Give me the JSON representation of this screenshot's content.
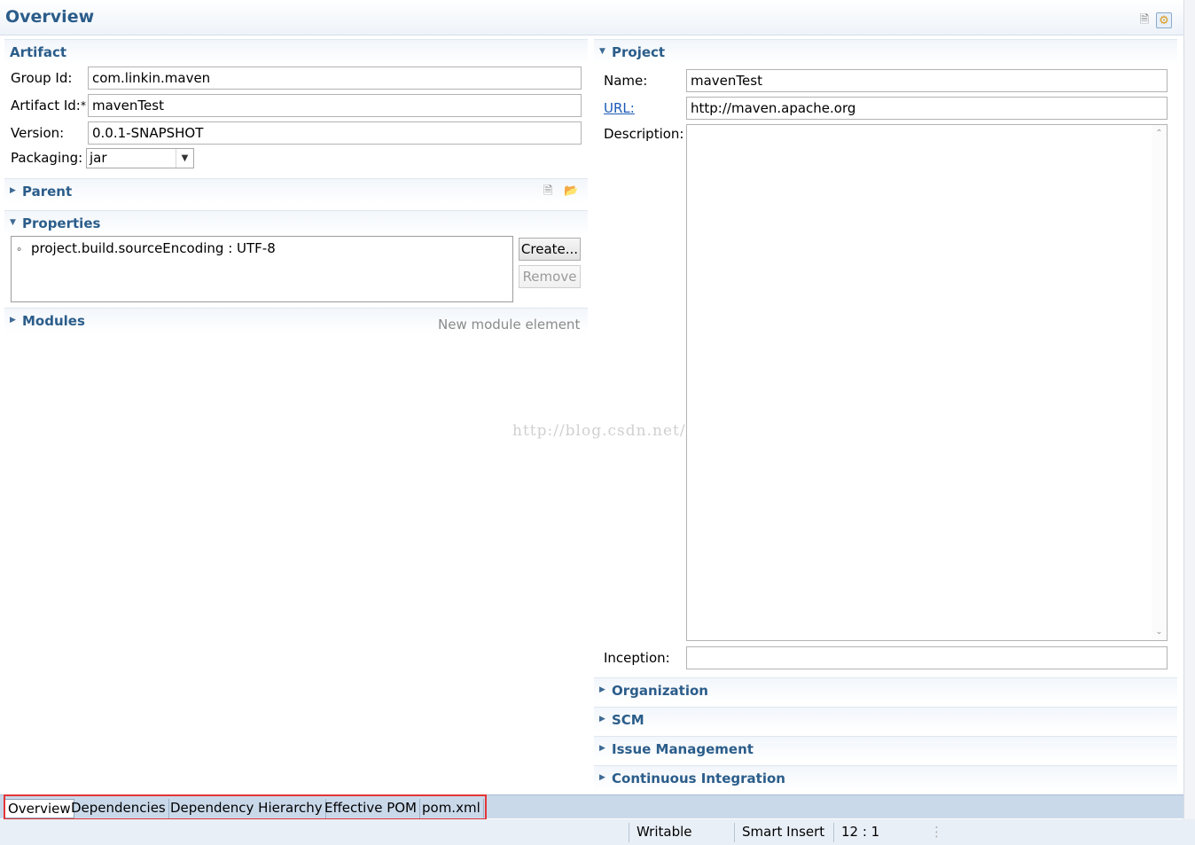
{
  "editor": {
    "title": "Overview"
  },
  "artifact": {
    "title": "Artifact",
    "group_id_label": "Group Id:",
    "group_id_value": "com.linkin.maven",
    "artifact_id_label": "Artifact Id:",
    "artifact_id_required": "*",
    "artifact_id_value": "mavenTest",
    "version_label": "Version:",
    "version_value": "0.0.1-SNAPSHOT",
    "packaging_label": "Packaging:",
    "packaging_value": "jar"
  },
  "parent": {
    "title": "Parent"
  },
  "properties": {
    "title": "Properties",
    "items": [
      "project.build.sourceEncoding : UTF-8"
    ],
    "create_label": "Create...",
    "remove_label": "Remove"
  },
  "modules": {
    "title": "Modules",
    "hint": "New module element"
  },
  "project": {
    "title": "Project",
    "name_label": "Name:",
    "name_value": "mavenTest",
    "url_label": "URL:",
    "url_value": "http://maven.apache.org",
    "description_label": "Description:",
    "description_value": "",
    "inception_label": "Inception:",
    "inception_value": ""
  },
  "collapsed_sections": [
    "Organization",
    "SCM",
    "Issue Management",
    "Continuous Integration"
  ],
  "watermark": "http://blog.csdn.net/",
  "tabs": [
    "Overview",
    "Dependencies",
    "Dependency Hierarchy",
    "Effective POM",
    "pom.xml"
  ],
  "status": {
    "writable": "Writable",
    "insert_mode": "Smart Insert",
    "position": "12 : 1"
  },
  "colors": {
    "section_title": "#2b5d8a",
    "link": "#1a5ab6",
    "tab_highlight": "#e23636"
  }
}
